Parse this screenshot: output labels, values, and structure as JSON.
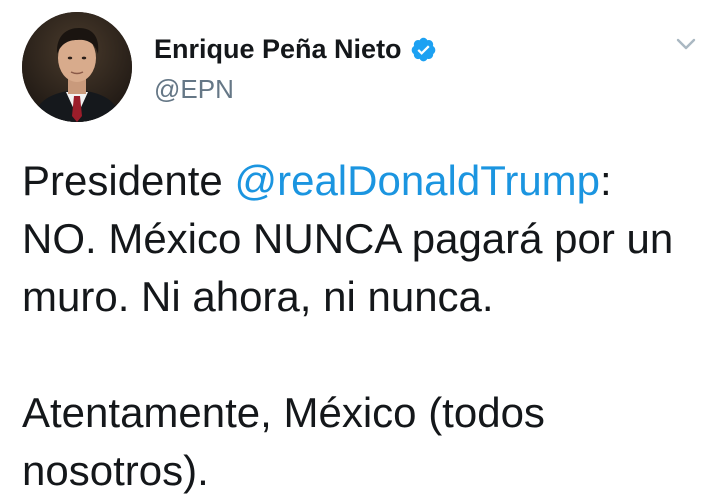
{
  "author": {
    "display_name": "Enrique Peña Nieto",
    "handle": "@EPN",
    "verified": true
  },
  "menu": {
    "icon": "chevron-down-icon"
  },
  "tweet": {
    "line1_prefix": "Presidente ",
    "mention": "@realDonaldTrump",
    "line1_suffix": ":",
    "line2": "NO. México NUNCA pagará por un",
    "line3": "muro. Ni ahora, ni nunca.",
    "line4": "",
    "line5": "Atentamente, México (todos",
    "line6": "nosotros)."
  },
  "colors": {
    "mention": "#1b95e0",
    "verified": "#1da1f2",
    "handle": "#657786",
    "text": "#14171a"
  }
}
